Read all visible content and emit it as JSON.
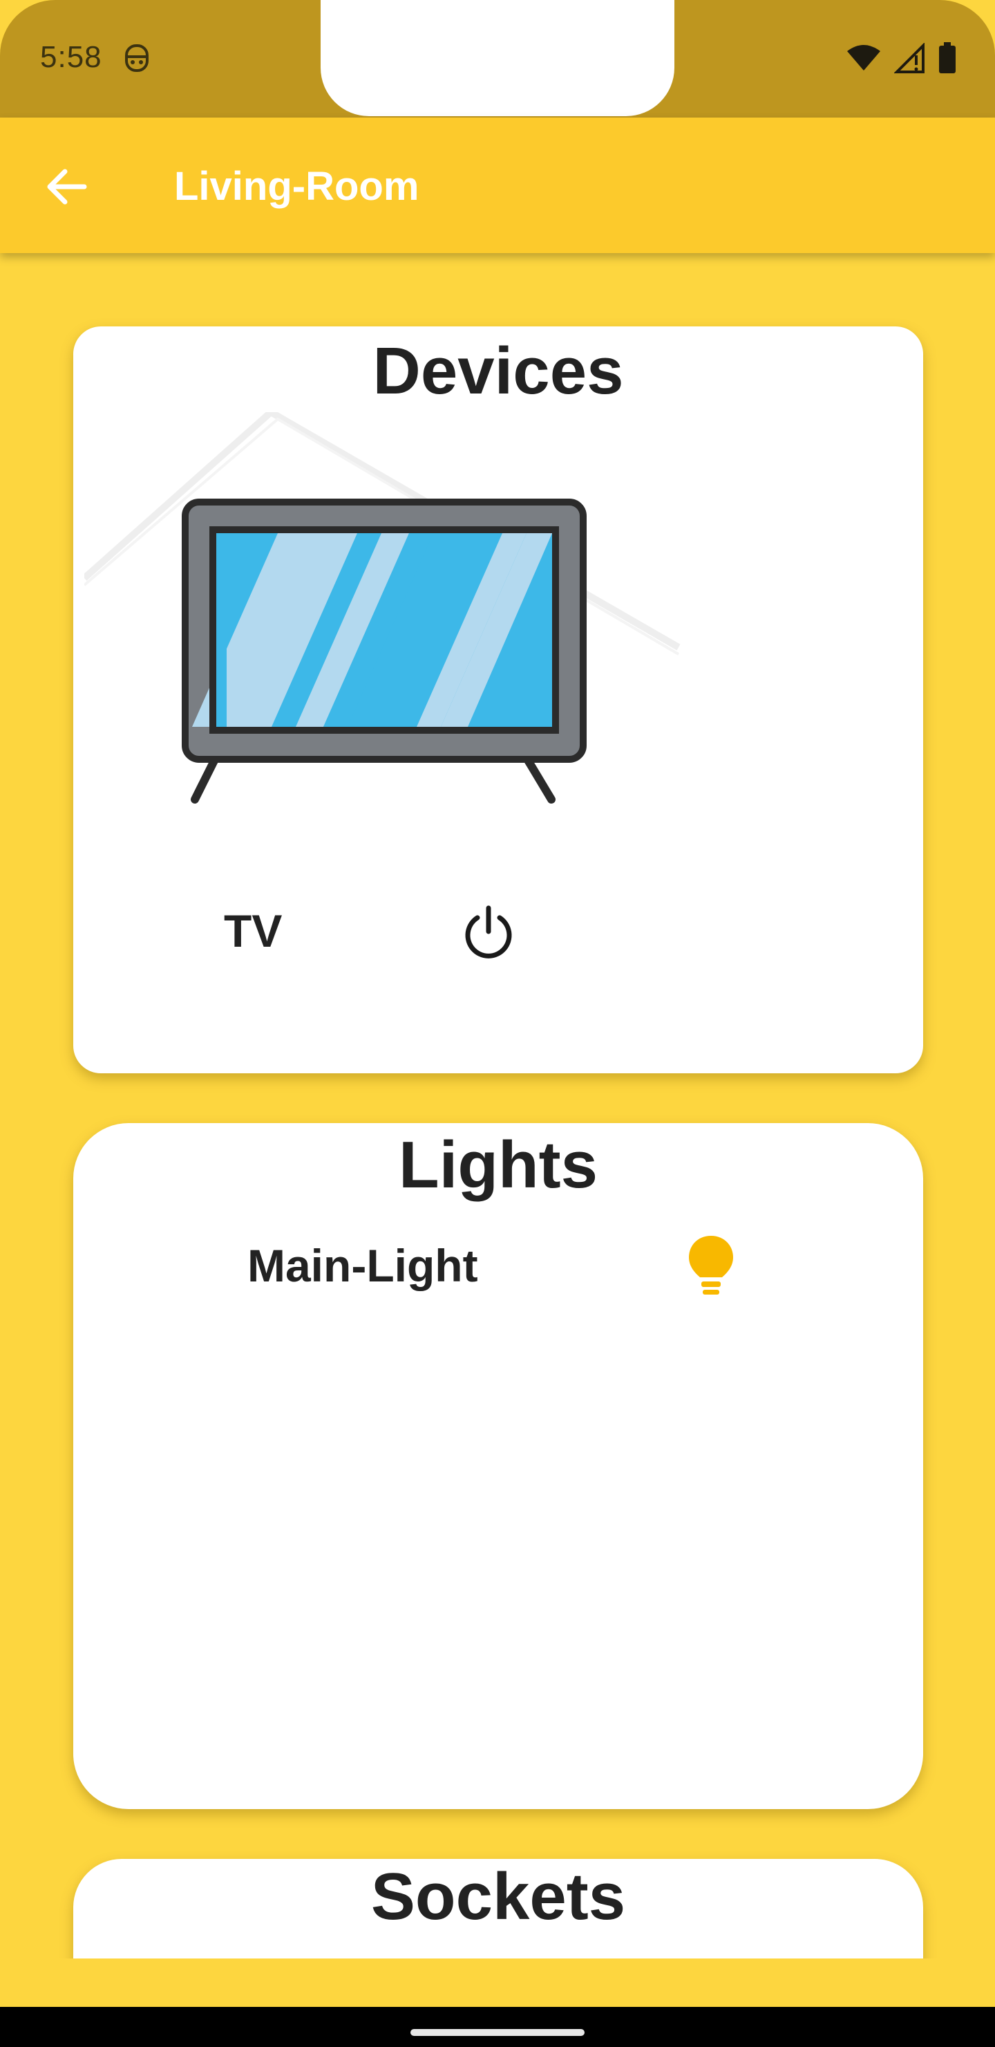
{
  "status_bar": {
    "time": "5:58",
    "icons": [
      "notification-face-icon",
      "wifi-icon",
      "signal-icon",
      "battery-icon"
    ]
  },
  "app_bar": {
    "title": "Living-Room",
    "back_icon": "arrow-back-icon"
  },
  "sections": {
    "devices": {
      "title": "Devices",
      "items": [
        {
          "label": "TV",
          "icon": "power-icon"
        }
      ]
    },
    "lights": {
      "title": "Lights",
      "items": [
        {
          "label": "Main-Light",
          "icon": "lightbulb-icon"
        }
      ]
    },
    "sockets": {
      "title": "Sockets"
    }
  },
  "colors": {
    "background": "#FDD63F",
    "app_bar": "#FCCA2C",
    "status_bar": "#BE961F",
    "bulb": "#F8B800"
  }
}
